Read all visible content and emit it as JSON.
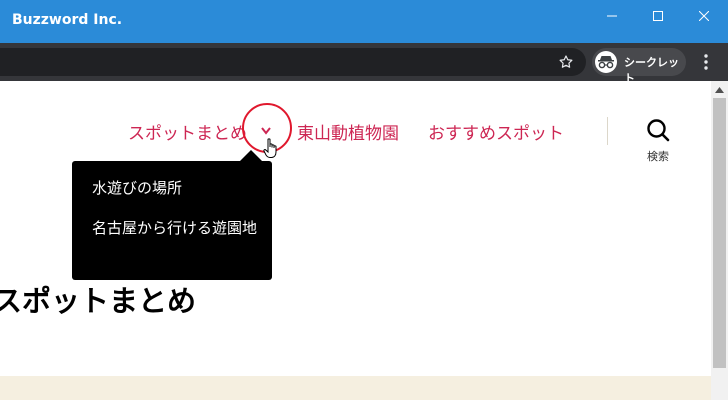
{
  "window": {
    "title": "Buzzword Inc."
  },
  "browser": {
    "profile_label": "シークレット"
  },
  "nav": {
    "items": [
      {
        "label": "スポットまとめ"
      },
      {
        "label": "東山動植物園"
      },
      {
        "label": "おすすめスポット"
      }
    ],
    "search_label": "検索"
  },
  "dropdown": {
    "items": [
      {
        "label": "水遊びの場所"
      },
      {
        "label": "名古屋から行ける遊園地"
      }
    ]
  },
  "content": {
    "heading": "スポットまとめ"
  },
  "colors": {
    "titlebar": "#2b8bd8",
    "nav_link": "#cd2653",
    "dropdown_bg": "#000000",
    "highlight_ring": "#e0182d",
    "footer_band": "#f5efe0"
  }
}
